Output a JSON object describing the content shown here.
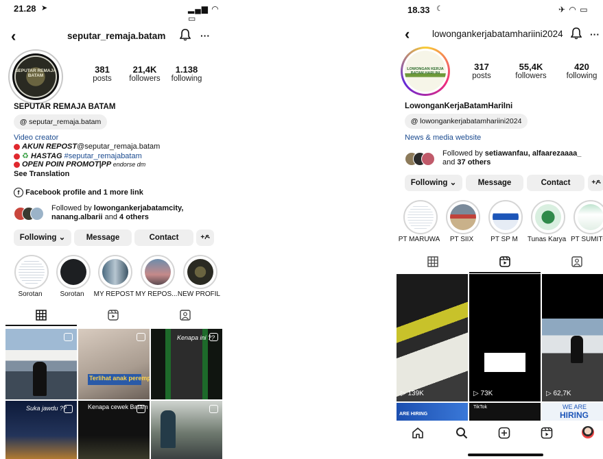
{
  "left": {
    "status_time": "21.28",
    "status_icons": "▂▄▆ ◠ ▭",
    "back": "‹",
    "username": "seputar_remaja.batam",
    "header_icons": [
      "bell-icon",
      "more-icon"
    ],
    "avatar_text": "SEPUTAR REMAJA BATAM",
    "posts": {
      "num": "381",
      "label": "posts"
    },
    "followers": {
      "num": "21,4K",
      "label": "followers"
    },
    "following": {
      "num": "1.138",
      "label": "following"
    },
    "display_name": "SEPUTAR REMAJA BATAM",
    "threads_handle": "seputar_remaja.batam",
    "category": "Video creator",
    "bio_lines": [
      {
        "prefix": "AKUN REPOST",
        "rest": "@seputar_remaja.batam"
      },
      {
        "prefix": "HASTAG",
        "rest": "#seputar_remajabatam"
      },
      {
        "prefix": "OPEN POIN PROMOT|PP",
        "rest": " endorse dm"
      }
    ],
    "see_translation": "See Translation",
    "facebook_link": "Facebook profile and 1 more link",
    "followed_by_pre": "Followed by ",
    "followed_by_names": "lowongankerjabatamcity, nanang.albarii",
    "followed_by_mid": " and ",
    "followed_by_others": "4 others",
    "buttons": {
      "following": "Following ⌄",
      "message": "Message",
      "contact": "Contact",
      "add": "+ዶ"
    },
    "highlights": [
      "Sorotan",
      "Sorotan",
      "MY REPOST",
      "MY REPOS...",
      "NEW PROFIL"
    ],
    "tabs": [
      "grid-icon",
      "reels-icon",
      "tagged-icon"
    ],
    "tiles": [
      {
        "caption": ""
      },
      {
        "caption": "Terlihat anak perempuan"
      },
      {
        "caption": "Kenapa ini ??"
      },
      {
        "caption": "Suka jawdu ??"
      },
      {
        "caption": "Kenapa cewek Batam"
      },
      {
        "caption": ""
      }
    ]
  },
  "right": {
    "status_time": "18.33",
    "status_icons": "✈ ◠ ▭",
    "back": "‹",
    "username": "lowongankerjabatamhariini2024",
    "avatar_text": "LOWONGAN KERJA BATAM HARI INI",
    "posts": {
      "num": "317",
      "label": "posts"
    },
    "followers": {
      "num": "55,4K",
      "label": "followers"
    },
    "following": {
      "num": "420",
      "label": "following"
    },
    "display_name": "LowonganKerjaBatamHariIni",
    "threads_handle": "lowongankerjabatamhariini2024",
    "category": "News & media website",
    "followed_by_pre": "Followed by ",
    "followed_by_names": "setiawanfau, alfaarezaaaa_",
    "followed_by_mid": "and ",
    "followed_by_others": "37 others",
    "buttons": {
      "following": "Following ⌄",
      "message": "Message",
      "contact": "Contact",
      "add": "+ዶ"
    },
    "highlights": [
      "PT MARUWA",
      "PT SIIX",
      "PT SP M",
      "Tunas Karya",
      "PT SUMITO"
    ],
    "tabs": [
      "grid-icon",
      "reels-icon",
      "tagged-icon"
    ],
    "reel_views": [
      "▷ 139K",
      "▷ 73K",
      "▷ 62,7K"
    ],
    "bottom_labels": [
      "ARE HIRING",
      "TikTok",
      "WE ARE",
      "HIRING"
    ],
    "nav": [
      "home-icon",
      "search-icon",
      "create-icon",
      "reels-icon",
      "profile-icon"
    ]
  }
}
